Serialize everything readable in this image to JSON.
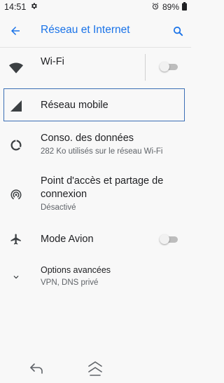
{
  "status_bar": {
    "time": "14:51",
    "battery": "89%",
    "icons": [
      "settings-gear-icon",
      "alarm-icon",
      "battery-icon"
    ]
  },
  "app_bar": {
    "title": "Réseau et Internet",
    "back_icon": "arrow-back-icon",
    "search_icon": "search-icon"
  },
  "items": [
    {
      "label": "Wi-Fi",
      "icon": "wifi-icon",
      "toggle": false
    },
    {
      "label": "Réseau mobile",
      "icon": "cellular-signal-icon",
      "focused": true
    },
    {
      "label": "Conso. des données",
      "sub": "282 Ko utilisés sur le réseau Wi-Fi",
      "icon": "data-usage-icon"
    },
    {
      "label_line1": "Point d'accès et partage de",
      "label_line2": "connexion",
      "sub": "Désactivé",
      "icon": "hotspot-icon"
    },
    {
      "label": "Mode Avion",
      "icon": "airplane-icon",
      "toggle": false
    },
    {
      "label": "Options avancées",
      "sub": "VPN, DNS privé",
      "icon": "chevron-down-icon"
    }
  ],
  "nav_bar": {
    "icons": [
      "nav-back-icon",
      "nav-home-icon"
    ]
  },
  "colors": {
    "accent": "#1a73e8",
    "background": "#f8f8f8",
    "text_primary": "#202124",
    "text_secondary": "#5f6368",
    "focus_border": "#3c6fb5"
  }
}
